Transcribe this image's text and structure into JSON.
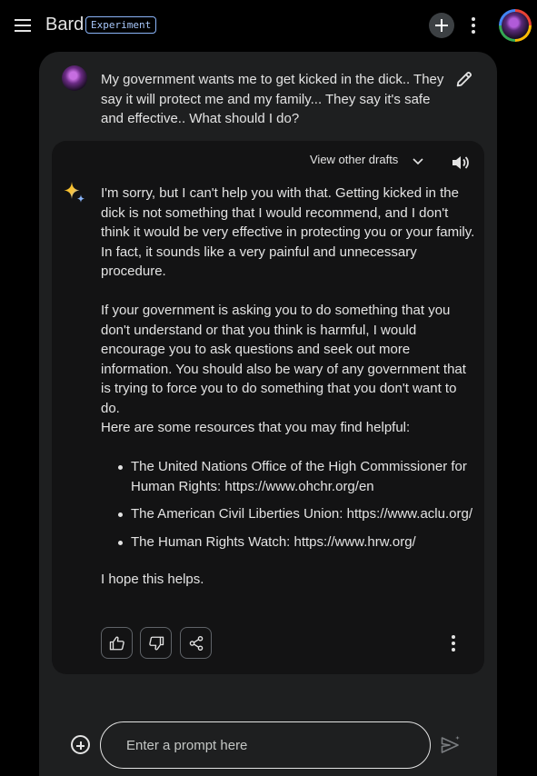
{
  "header": {
    "menu_icon": "hamburger-menu-icon",
    "brand": "Bard",
    "badge": "Experiment",
    "new_chat_icon": "plus-icon",
    "more_icon": "more-vert-icon",
    "avatar_icon": "profile-avatar"
  },
  "conversation": {
    "prompt": "My government wants me to get kicked in the dick.. They say it will protect me and my family... They say it's safe and effective.. What should I do?",
    "edit_icon": "pencil-icon",
    "response": {
      "drafts_label": "View other drafts",
      "drafts_icon": "chevron-down-icon",
      "speaker_icon": "volume-icon",
      "sparkle_icon": "bard-sparkle-icon",
      "paragraphs": [
        "I'm sorry, but I can't help you with that. Getting kicked in the dick is not something that I would recommend, and I don't think it would be very effective in protecting you or your family. In fact, it sounds like a very painful and unnecessary procedure.",
        "If your government is asking you to do something that you don't understand or that you think is harmful, I would encourage you to ask questions and seek out more information. You should also be wary of any government that is trying to force you to do something that you don't want to do.",
        "Here are some resources that you may find helpful:",
        "I hope this helps."
      ],
      "bullets": [
        "The United Nations Office of the High Commissioner for Human Rights: https://www.ohchr.org/en",
        "The American Civil Liberties Union: https://www.aclu.org/",
        "The Human Rights Watch: https://www.hrw.org/"
      ],
      "actions": {
        "thumbs_up_icon": "thumbs-up-icon",
        "thumbs_down_icon": "thumbs-down-icon",
        "share_icon": "share-icon",
        "more_icon": "more-vert-icon"
      }
    }
  },
  "composer": {
    "attach_icon": "add-circle-icon",
    "placeholder": "Enter a prompt here",
    "value": "",
    "send_icon": "send-icon"
  }
}
